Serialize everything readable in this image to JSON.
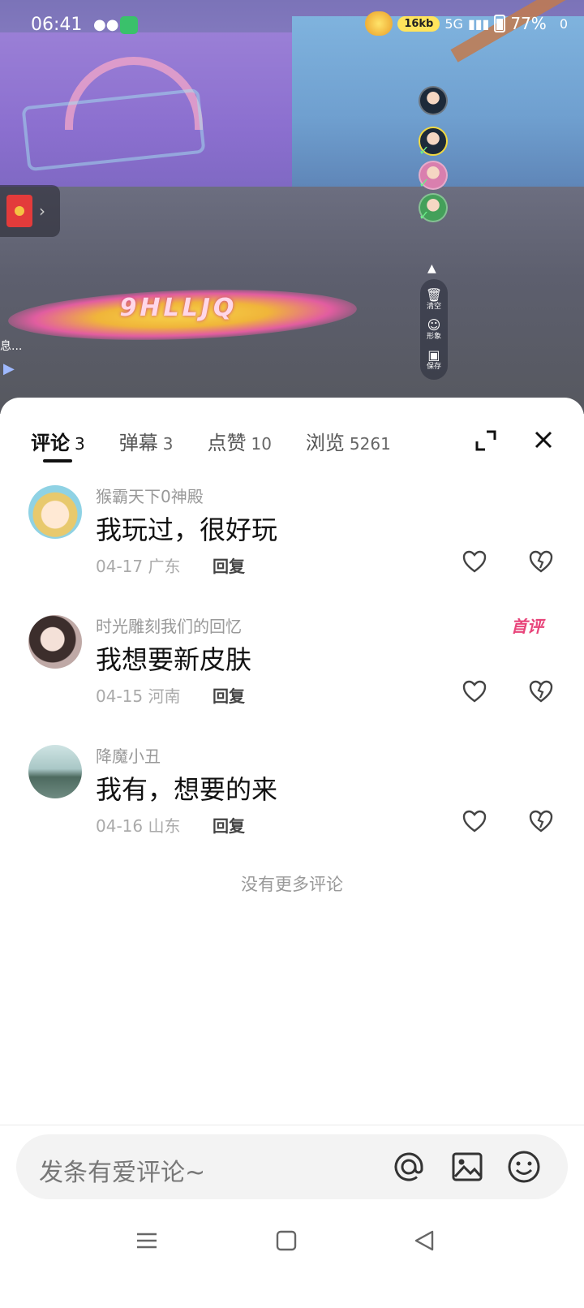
{
  "status_bar": {
    "time": "06:41",
    "speed": "16kb",
    "network": "5G",
    "battery": "77%",
    "extra": "0",
    "icons": [
      "wechat-icon",
      "app-icon",
      "wifi-icon",
      "signal-icon",
      "battery-icon"
    ]
  },
  "video": {
    "left_text": "息...",
    "floor_logo_text": "9HLLJQ",
    "red_packet_icon": "red-packet-icon",
    "side_tools": [
      {
        "label": "清空",
        "icon": "trash-icon"
      },
      {
        "label": "形象",
        "icon": "avatar-icon"
      },
      {
        "label": "保存",
        "icon": "save-icon"
      }
    ]
  },
  "panel": {
    "tabs": [
      {
        "label": "评论",
        "count": "3"
      },
      {
        "label": "弹幕",
        "count": "3"
      },
      {
        "label": "点赞",
        "count": "10"
      },
      {
        "label": "浏览",
        "count": "5261"
      }
    ],
    "comments": [
      {
        "user": "猴霸天下0神殿",
        "text": "我玩过，很好玩",
        "meta": "04-17 广东",
        "reply": "回复",
        "badge": ""
      },
      {
        "user": "时光雕刻我们的回忆",
        "text": "我想要新皮肤",
        "meta": "04-15 河南",
        "reply": "回复",
        "badge": "首评"
      },
      {
        "user": "降魔小丑",
        "text": "我有，想要的来",
        "meta": "04-16 山东",
        "reply": "回复",
        "badge": ""
      }
    ],
    "no_more": "没有更多评论",
    "input_placeholder": "发条有爱评论~"
  },
  "colors": {
    "badge": "#e8447a",
    "text_primary": "#111111",
    "text_secondary": "#999999"
  }
}
